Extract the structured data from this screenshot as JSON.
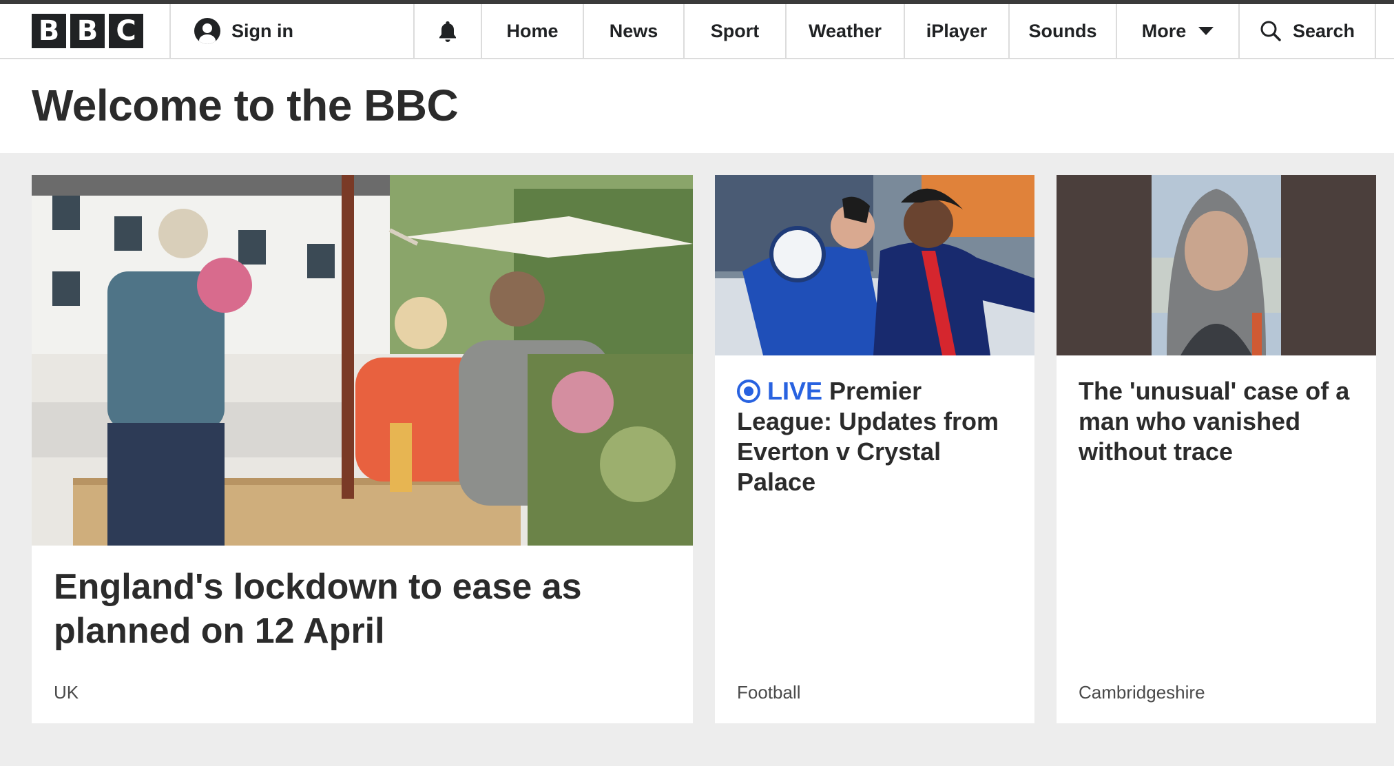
{
  "header": {
    "logo_letters": [
      "B",
      "B",
      "C"
    ],
    "signin_label": "Sign in",
    "nav": [
      "Home",
      "News",
      "Sport",
      "Weather",
      "iPlayer",
      "Sounds"
    ],
    "more_label": "More",
    "search_label": "Search"
  },
  "page": {
    "welcome": "Welcome to the BBC"
  },
  "cards": [
    {
      "title": "England's lockdown to ease as planned on 12 April",
      "tag": "UK"
    },
    {
      "live_label": "LIVE",
      "title": "Premier League: Updates from Everton v Crystal Palace",
      "tag": "Football"
    },
    {
      "title": "The 'unusual' case of a man who vanished without trace",
      "tag": "Cambridgeshire"
    }
  ],
  "colors": {
    "live_blue": "#2862e0",
    "band_grey": "#ededed"
  }
}
